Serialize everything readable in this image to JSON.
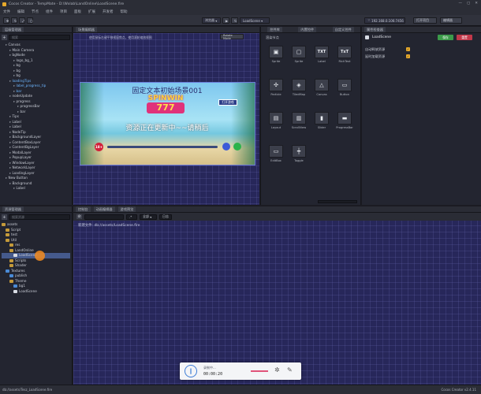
{
  "window": {
    "title": "Cocos Creator - TempMate - D:\\Wxlab\\LandOnline\\LoadScene.fire",
    "version": "Cocos Creator v2.4.11"
  },
  "menu": [
    "文件",
    "编辑",
    "节点",
    "组件",
    "项目",
    "面板",
    "扩展",
    "开发者",
    "帮助"
  ],
  "toolbar": {
    "preview_mode": "浏览器",
    "scene_label": "LoadScene",
    "ip": "192.168.0.106:7456",
    "btn_open": "打开项目",
    "btn_editor": "编辑器"
  },
  "hierarchy": {
    "tab": "层级管理器",
    "search_placeholder": "搜索",
    "rows": [
      {
        "text": "Canvas",
        "indent": 1,
        "blue": false
      },
      {
        "text": "Main Camera",
        "indent": 2,
        "blue": false
      },
      {
        "text": "bgNode",
        "indent": 2,
        "blue": false
      },
      {
        "text": "logo_bg_1",
        "indent": 3,
        "blue": false
      },
      {
        "text": "bg",
        "indent": 3,
        "blue": false
      },
      {
        "text": "bg",
        "indent": 3,
        "blue": false
      },
      {
        "text": "bg",
        "indent": 3,
        "blue": false
      },
      {
        "text": "loadingTips",
        "indent": 2,
        "blue": true
      },
      {
        "text": "label_progress_tip",
        "indent": 3,
        "blue": true
      },
      {
        "text": "bar",
        "indent": 3,
        "blue": true
      },
      {
        "text": "nodeUpdate",
        "indent": 2,
        "blue": false
      },
      {
        "text": "progress",
        "indent": 3,
        "blue": false
      },
      {
        "text": "progressBar",
        "indent": 4,
        "blue": false
      },
      {
        "text": "bar",
        "indent": 4,
        "blue": false
      },
      {
        "text": "Tips",
        "indent": 2,
        "blue": false
      },
      {
        "text": "Label",
        "indent": 2,
        "blue": false
      },
      {
        "text": "Label",
        "indent": 2,
        "blue": false
      },
      {
        "text": "NodeTip",
        "indent": 2,
        "blue": false
      },
      {
        "text": "BackgroundLayer",
        "indent": 2,
        "blue": false
      },
      {
        "text": "ContentBoxLayer",
        "indent": 2,
        "blue": false
      },
      {
        "text": "ContentBgLayer",
        "indent": 2,
        "blue": false
      },
      {
        "text": "ModalLayer",
        "indent": 2,
        "blue": false
      },
      {
        "text": "PopupLayer",
        "indent": 2,
        "blue": false
      },
      {
        "text": "WindowLayer",
        "indent": 2,
        "blue": false
      },
      {
        "text": "NetworkLayer",
        "indent": 2,
        "blue": false
      },
      {
        "text": "LoadingLayer",
        "indent": 2,
        "blue": false
      },
      {
        "text": "New Button",
        "indent": 1,
        "blue": false
      },
      {
        "text": "Background",
        "indent": 2,
        "blue": false
      },
      {
        "text": "Label",
        "indent": 3,
        "blue": false
      }
    ]
  },
  "scene": {
    "tab": "场景编辑器",
    "hint": "使用鼠标右键平移视窗焦点，使用滚轮缩放视图",
    "zoom_btn": "Rotate Mode",
    "game": {
      "title": "固定文本初始场景001",
      "logo_top": "SPINWIN",
      "logo_num": "777",
      "button": "打开游戏",
      "tip": "资源正在更新中~~请稍后",
      "age": "18+"
    }
  },
  "components": {
    "tabs": [
      "控件库",
      "内置控件",
      "自定义控件"
    ],
    "section": "渲染节点",
    "items": [
      {
        "label": "Sprite",
        "glyph": "▣"
      },
      {
        "label": "Sprite",
        "glyph": "▢"
      },
      {
        "label": "Label",
        "glyph": "TXT"
      },
      {
        "label": "RichText",
        "glyph": "TxT"
      },
      {
        "label": "Particle",
        "glyph": "✣"
      },
      {
        "label": "TiledMap",
        "glyph": "◈"
      },
      {
        "label": "Canvas",
        "glyph": "△"
      },
      {
        "label": "Button",
        "glyph": "▭"
      },
      {
        "label": "Layout",
        "glyph": "▤"
      },
      {
        "label": "ScrollView",
        "glyph": "▥"
      },
      {
        "label": "Slider",
        "glyph": "▮"
      },
      {
        "label": "ProgressBar",
        "glyph": "▬"
      },
      {
        "label": "EditBox",
        "glyph": "▭"
      },
      {
        "label": "Toggle",
        "glyph": "┿"
      }
    ]
  },
  "inspector": {
    "tab": "属性检查器",
    "node_name": "LoadScene",
    "btn_save": "保存",
    "btn_reset": "重置",
    "fields": [
      {
        "label": "自动释放资源",
        "checked": true
      },
      {
        "label": "延时加载资源",
        "checked": true
      }
    ]
  },
  "assets": {
    "tab": "资源管理器",
    "search_placeholder": "搜索资源",
    "rows": [
      {
        "text": "assets",
        "indent": 0,
        "color": "folder"
      },
      {
        "text": "Script",
        "indent": 1,
        "color": "folder"
      },
      {
        "text": "test",
        "indent": 1,
        "color": "folder"
      },
      {
        "text": "Util",
        "indent": 1,
        "color": "folder"
      },
      {
        "text": "res",
        "indent": 2,
        "color": "folder"
      },
      {
        "text": "LandOnline",
        "indent": 2,
        "color": "folder"
      },
      {
        "text": "LoadScene",
        "indent": 3,
        "color": "white"
      },
      {
        "text": "Scripts",
        "indent": 2,
        "color": "folder"
      },
      {
        "text": "Shader",
        "indent": 2,
        "color": "folder"
      },
      {
        "text": "Textures",
        "indent": 1,
        "color": "blue"
      },
      {
        "text": "publish",
        "indent": 2,
        "color": "blue"
      },
      {
        "text": "Theme",
        "indent": 2,
        "color": "folder"
      },
      {
        "text": "bg1",
        "indent": 3,
        "color": "blue"
      },
      {
        "text": "LoadScene",
        "indent": 3,
        "color": "white"
      }
    ],
    "footer": "db://assets/Tesz_LoadScene.fire"
  },
  "console": {
    "tabs": [
      "控制台",
      "动画编辑器",
      "游戏预览"
    ],
    "filter_all": "全部",
    "filter_level": "日志",
    "log": "新建文件: db://assets/LoadScene.fire"
  },
  "recorder": {
    "title": "录制中...",
    "time": "00:00:20"
  },
  "colors": {
    "scene_bg": "#27275a",
    "accent": "#4a8ad6",
    "save": "#3c9b4a",
    "reset": "#c2384a"
  }
}
